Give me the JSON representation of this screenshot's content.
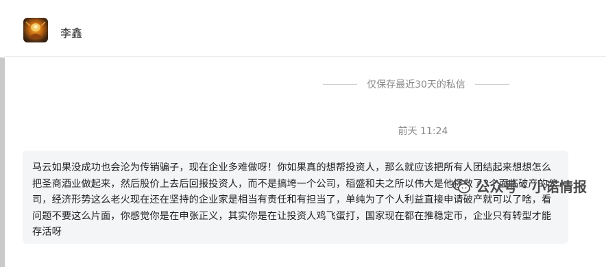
{
  "contact": {
    "name": "李鑫",
    "avatar_icon": "avatar-image-icon"
  },
  "chat": {
    "notice": "仅保存最近30天的私信",
    "timestamp": "前天 11:24",
    "messages": [
      {
        "text": "马云如果没成功也会沦为传销骗子，现在企业多难做呀！你如果真的想帮投资人，那么就应该把所有人团结起来想想怎么把圣商酒业做起来，然后股价上去后回报投资人，而不是搞垮一个公司，稻盛和夫之所以伟大是他拯救了3个面临破产的公司，经济形势这么老火现在还在坚持的企业家是相当有责任和有担当了，单纯为了个人利益直接申请破产就可以了啥，看问题不要这么片面，你感觉你是在申张正义，其实你是在让投资人鸡飞蛋打，国家现在都在推稳定币，企业只有转型才能存活呀"
      }
    ]
  },
  "watermark": {
    "text": "公众号 · 小诺情报",
    "icon": "wechat-icon"
  },
  "colors": {
    "bubble_bg": "#f4f5f7",
    "meta_text": "#8a8a8a",
    "divider": "#ececec"
  }
}
